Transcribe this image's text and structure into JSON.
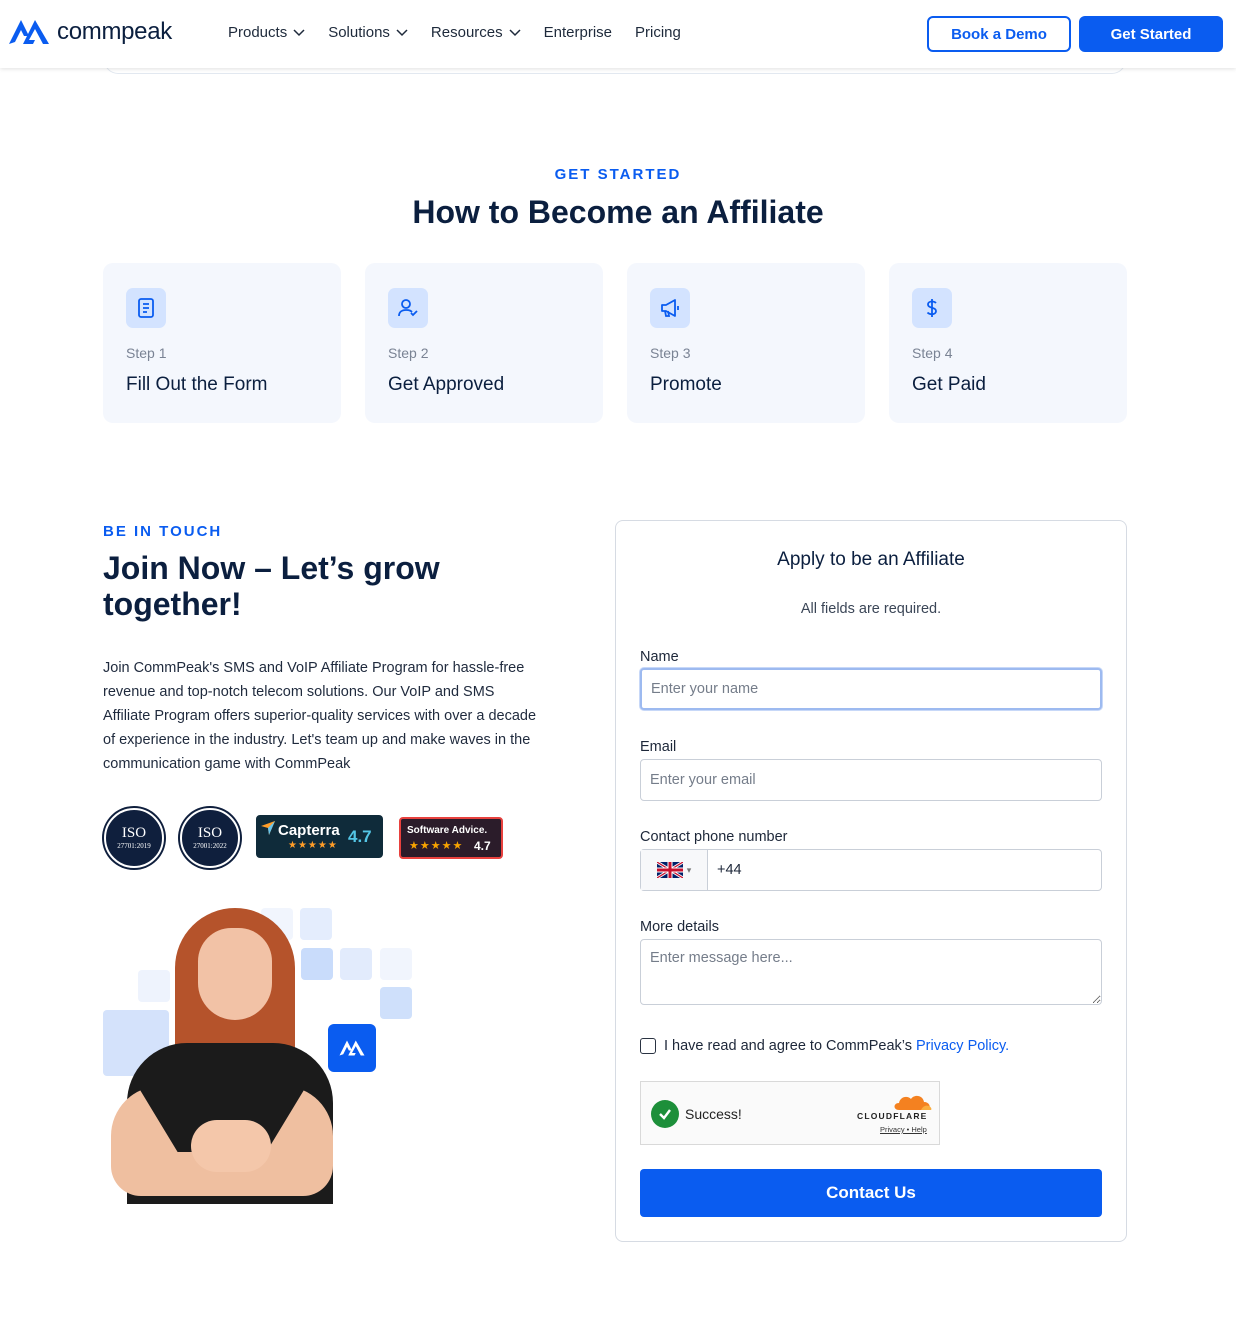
{
  "header": {
    "brand": "commpeak",
    "nav": [
      {
        "label": "Products",
        "has_dropdown": true
      },
      {
        "label": "Solutions",
        "has_dropdown": true
      },
      {
        "label": "Resources",
        "has_dropdown": true
      },
      {
        "label": "Enterprise",
        "has_dropdown": false
      },
      {
        "label": "Pricing",
        "has_dropdown": false
      }
    ],
    "book_demo": "Book a Demo",
    "get_started": "Get Started"
  },
  "steps_section": {
    "eyebrow": "GET STARTED",
    "title": "How to Become an Affiliate",
    "steps": [
      {
        "num": "Step 1",
        "title": "Fill Out the Form",
        "icon": "document-icon"
      },
      {
        "num": "Step 2",
        "title": "Get Approved",
        "icon": "user-check-icon"
      },
      {
        "num": "Step 3",
        "title": "Promote",
        "icon": "megaphone-icon"
      },
      {
        "num": "Step 4",
        "title": "Get Paid",
        "icon": "dollar-icon"
      }
    ]
  },
  "touch_section": {
    "eyebrow": "BE IN TOUCH",
    "title": "Join Now – Let’s grow together!",
    "body": "Join CommPeak's SMS and VoIP Affiliate Program for hassle-free revenue and top-notch telecom solutions. Our VoIP and SMS Affiliate Program offers superior-quality services with over a decade of experience in the industry. Let's team up and make waves in the communication game with CommPeak",
    "badges": {
      "iso1_title": "ISO",
      "iso1_code": "27701:2019",
      "iso2_title": "ISO",
      "iso2_code": "27001:2022",
      "capterra_name": "Capterra",
      "capterra_rating": "4.7",
      "software_advice_name": "Software Advice.",
      "software_advice_rating": "4.7"
    }
  },
  "form": {
    "title": "Apply to be an Affiliate",
    "subtitle": "All fields are required.",
    "name_label": "Name",
    "name_placeholder": "Enter your name",
    "email_label": "Email",
    "email_placeholder": "Enter your email",
    "phone_label": "Contact phone number",
    "phone_value": "+44",
    "details_label": "More details",
    "details_placeholder": "Enter message here...",
    "agree_text": "I have read and agree to CommPeak’s",
    "privacy_link": "Privacy Policy.",
    "captcha_status": "Success!",
    "captcha_brand": "CLOUDFLARE",
    "captcha_links": "Privacy • Help",
    "submit": "Contact Us"
  },
  "colors": {
    "brand_blue": "#0a5cf0",
    "navy_text": "#0b1f3f",
    "card_bg": "#f4f7fd",
    "icon_bg": "#d3e3ff"
  }
}
